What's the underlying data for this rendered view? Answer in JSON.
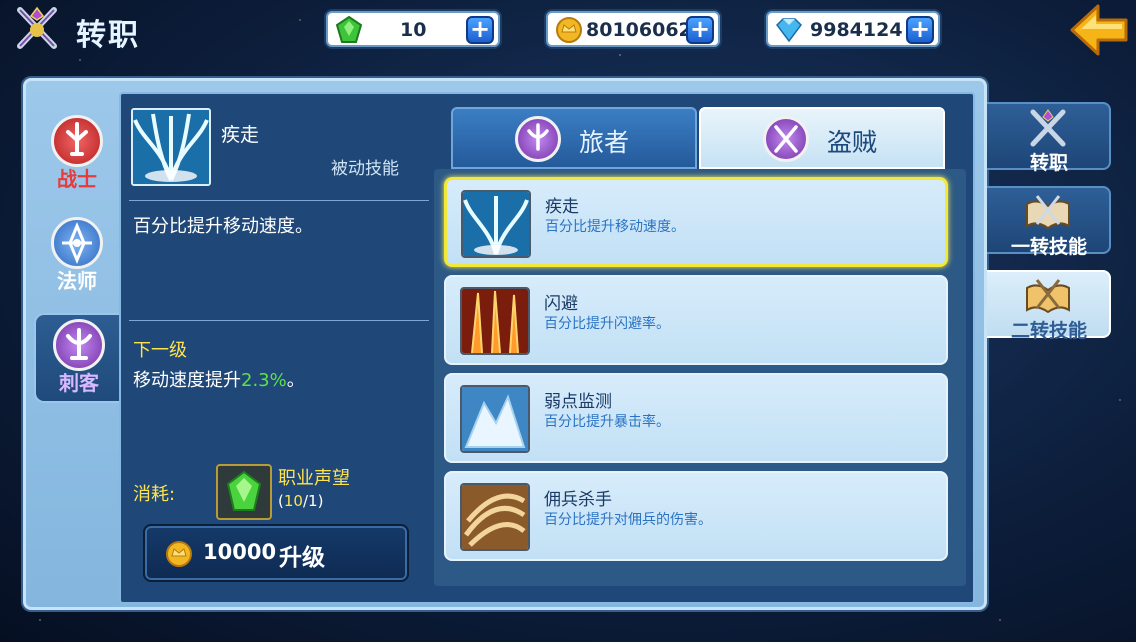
{
  "header": {
    "title": "转职",
    "title_icon": "crossed-swords-crest-icon",
    "back_icon": "back-arrow-icon"
  },
  "resources": [
    {
      "name": "gem",
      "icon": "green-gem-icon",
      "value": "10"
    },
    {
      "name": "gold",
      "icon": "gold-coin-icon",
      "value": "80106062"
    },
    {
      "name": "diamond",
      "icon": "diamond-icon",
      "value": "9984124"
    }
  ],
  "left_tabs": [
    {
      "label": "战士",
      "icon": "warrior-badge-icon",
      "color": "#e23b3b"
    },
    {
      "label": "法师",
      "icon": "mage-badge-icon",
      "color": "#4a8ee0"
    },
    {
      "label": "刺客",
      "icon": "assassin-badge-icon",
      "color": "#9a4fc7",
      "active": true
    }
  ],
  "detail": {
    "name": "疾走",
    "type": "被动技能",
    "description": "百分比提升移动速度。",
    "next_level_title": "下一级",
    "next_level_prefix": "移动速度提升",
    "next_level_value": "2.3%",
    "next_level_suffix": "。",
    "cost_label": "消耗:",
    "cost_item": "职业声望",
    "cost_have": "10",
    "cost_need": "/1",
    "upgrade_price": "10000",
    "upgrade_label": "升级"
  },
  "class_tabs": [
    {
      "label": "旅者",
      "selected": true
    },
    {
      "label": "盗贼",
      "selected": false
    }
  ],
  "skills": [
    {
      "name": "疾走",
      "desc": "百分比提升移动速度。",
      "icon": "wind-burst-skill-icon",
      "selected": true
    },
    {
      "name": "闪避",
      "desc": "百分比提升闪避率。",
      "icon": "fire-blades-skill-icon"
    },
    {
      "name": "弱点监测",
      "desc": "百分比提升暴击率。",
      "icon": "ice-peak-skill-icon"
    },
    {
      "name": "佣兵杀手",
      "desc": "百分比提升对佣兵的伤害。",
      "icon": "sand-vortex-skill-icon"
    }
  ],
  "right_tabs": [
    {
      "label": "转职",
      "icon": "crest-icon"
    },
    {
      "label": "一转技能",
      "icon": "open-book-icon"
    },
    {
      "label": "二转技能",
      "icon": "open-book-gold-icon",
      "active": true
    }
  ]
}
